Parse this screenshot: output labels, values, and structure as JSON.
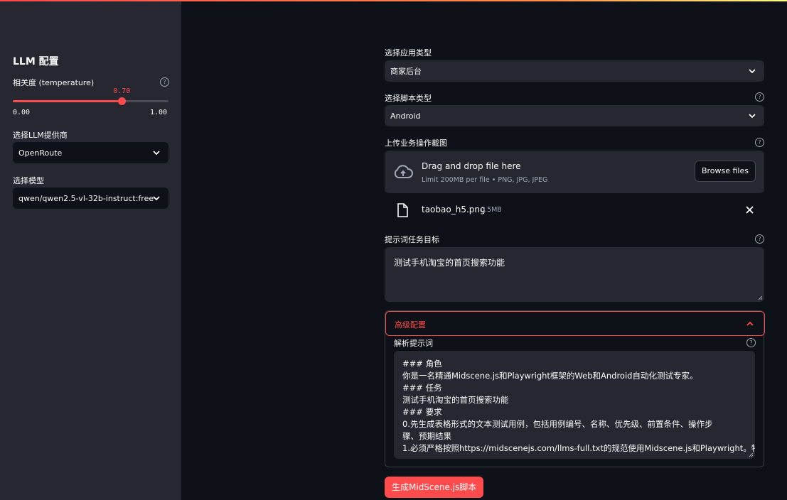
{
  "sidebar": {
    "title": "LLM 配置",
    "temperature": {
      "label": "相关度 (temperature)",
      "value": 0.7,
      "value_text": "0.70",
      "min_text": "0.00",
      "max_text": "1.00"
    },
    "provider": {
      "label": "选择LLM提供商",
      "value": "OpenRoute"
    },
    "model": {
      "label": "选择模型",
      "value": "qwen/qwen2.5-vl-32b-instruct:free"
    }
  },
  "main": {
    "app_type": {
      "label": "选择应用类型",
      "value": "商家后台"
    },
    "script_type": {
      "label": "选择脚本类型",
      "value": "Android"
    },
    "upload": {
      "label": "上传业务操作截图",
      "drag_text": "Drag and drop file here",
      "limit_text": "Limit 200MB per file • PNG, JPG, JPEG",
      "browse_label": "Browse files",
      "file_name": "taobao_h5.png",
      "file_size": "0.5MB"
    },
    "goal": {
      "label": "提示词任务目标",
      "value": "测试手机淘宝的首页搜索功能"
    },
    "advanced": {
      "title": "高级配置",
      "prompt_label": "解析提示词",
      "prompt_lines": [
        "### 角色",
        "你是一名精通Midscene.js和Playwright框架的Web和Android自动化测试专家。",
        "### 任务",
        "测试手机淘宝的首页搜索功能",
        "### 要求",
        "0.先生成表格形式的文本测试用例，包括用例编号、名称、优先级、前置条件、操作步",
        "骤、预期结果",
        "1.必须严格按照https://midscenejs.com/llms-full.txt的规范使用Midscene.js和Playwright。特"
      ]
    },
    "generate_label": "生成MidScene.js脚本"
  },
  "colors": {
    "accent": "#ff4b4b",
    "bg": "#0e1117",
    "sidebar_bg": "#262730"
  }
}
